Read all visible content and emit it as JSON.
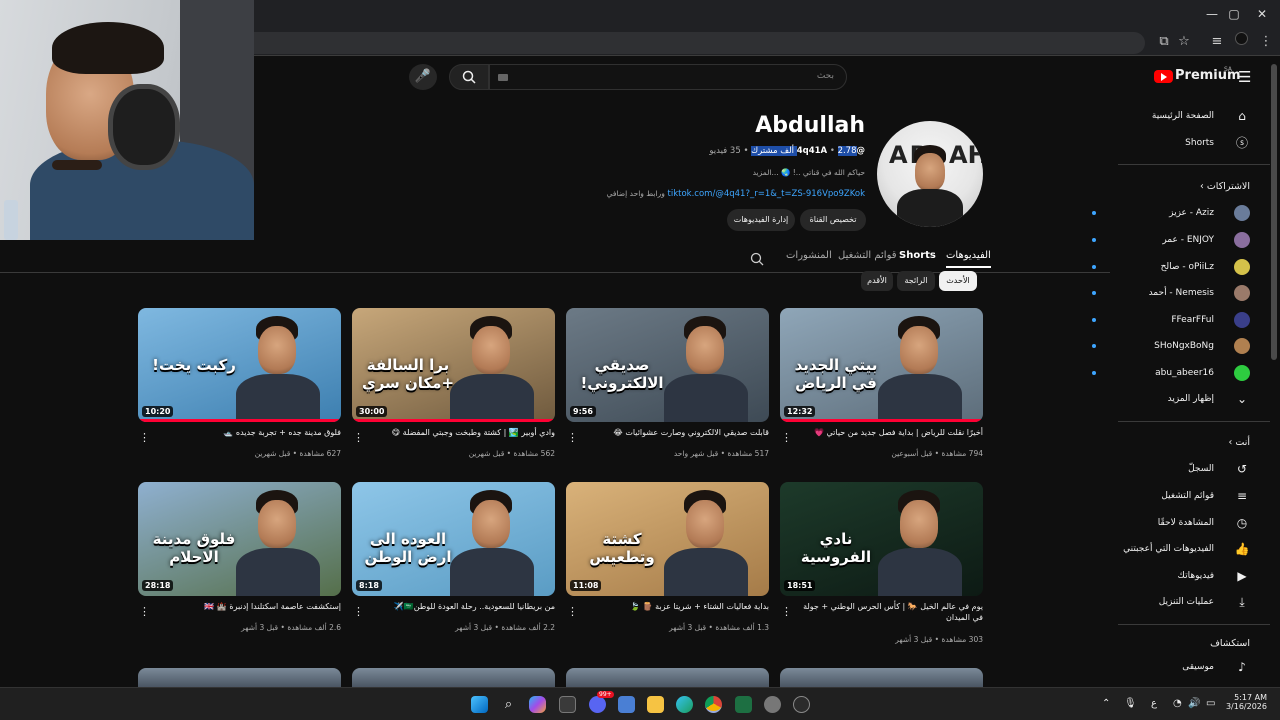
{
  "browser": {
    "window_controls": {
      "minimize": "—",
      "maximize": "▢",
      "close": "✕"
    }
  },
  "youtube": {
    "logo_text": "Premium",
    "logo_region": "SA",
    "search_placeholder": "بحث",
    "sidebar": {
      "main": [
        {
          "label": "الصفحة الرئيسية",
          "icon": "home-icon"
        },
        {
          "label": "Shorts",
          "icon": "shorts-icon"
        }
      ],
      "subscriptions_title": "الاشتراكات",
      "subscriptions": [
        {
          "label": "Aziz - عزيز",
          "color": "#6a7c9a"
        },
        {
          "label": "ENJOY - عمر",
          "color": "#8a6e9e"
        },
        {
          "label": "oPiiLz - صالح",
          "color": "#d4c14a"
        },
        {
          "label": "Nemesis - أحمد",
          "color": "#9a7a6a"
        },
        {
          "label": "FFearFFul",
          "color": "#3a3f8a"
        },
        {
          "label": "SHoNgxBoNg",
          "color": "#b08050"
        },
        {
          "label": "abu_abeer16",
          "color": "#2ecc40"
        }
      ],
      "show_more": "إظهار المزيد",
      "you_title": "أنت",
      "you": [
        {
          "label": "السجلّ",
          "icon": "history-icon"
        },
        {
          "label": "قوائم التشغيل",
          "icon": "playlists-icon"
        },
        {
          "label": "المشاهدة لاحقًا",
          "icon": "watch-later-icon"
        },
        {
          "label": "الفيديوهات التي أعجبتني",
          "icon": "liked-videos-icon"
        },
        {
          "label": "فيديوهاتك",
          "icon": "your-videos-icon"
        },
        {
          "label": "عمليات التنزيل",
          "icon": "downloads-icon"
        }
      ],
      "explore_title": "استكشاف",
      "explore": [
        {
          "label": "موسيقى",
          "icon": "music-icon"
        }
      ]
    },
    "channel": {
      "name": "Abdullah",
      "handle": "@4q41A",
      "subscribers": "2.78 ألف مشترك",
      "videos_count": "35 فيديو",
      "description": "حياكم الله في قناتي ..! 🌏 ...المزيد",
      "link": "tiktok.com/@4q41?_r=1&_t=ZS-916Vpo9ZKok",
      "link_suffix": "ورابط واحد إضافي",
      "customize_button": "تخصيص القناة",
      "manage_button": "إدارة الفيديوهات",
      "tabs": [
        "الفيديوهات",
        "Shorts",
        "قوائم التشغيل",
        "المنشورات"
      ],
      "chips": [
        "الأحدث",
        "الرائجة",
        "الأقدم"
      ]
    },
    "videos": [
      {
        "title": "أخيرًا نقلت للرياض | بداية فصل جديد من حياتي 💗",
        "meta": "794 مشاهدة • قبل أسبوعين",
        "duration": "12:32",
        "overlay": "بيتي الجديد في الرياض",
        "bg1": "#8fa6b8",
        "bg2": "#5d6d7a",
        "progress": 1.0
      },
      {
        "title": "قابلت صديقي الالكتروني وصارت عشوائيات 😂",
        "meta": "517 مشاهدة • قبل شهر واحد",
        "duration": "9:56",
        "overlay": "صديقي الالكتروني!",
        "bg1": "#6c7a86",
        "bg2": "#3e4a55",
        "progress": 0.0
      },
      {
        "title": "وادي أوبير 🏞️ | كشتة وطبخت وجبتي المفضلة 😋",
        "meta": "562 مشاهدة • قبل شهرين",
        "duration": "30:00",
        "overlay": "برا السالفة +مكان سري",
        "bg1": "#c7a77a",
        "bg2": "#6f5a3e",
        "progress": 1.0
      },
      {
        "title": "فلوق مدينة جده + تجربة جديده 🛥️",
        "meta": "627 مشاهدة • قبل شهرين",
        "duration": "10:20",
        "overlay": "ركبت يخت!",
        "bg1": "#7fb8e0",
        "bg2": "#3d7fb0",
        "progress": 1.0
      },
      {
        "title": "يوم في عالم الخيل 🐎 | كأس الحرس الوطني + جولة في الميدان",
        "meta": "303 مشاهدة • قبل 3 أشهر",
        "duration": "18:51",
        "overlay": "نادي الفروسية",
        "bg1": "#1d3a2a",
        "bg2": "#0d1a14",
        "progress": 0.0
      },
      {
        "title": "بداية فعاليات الشتاء + شريتا عزبة 🪵 🍃",
        "meta": "1.3 ألف مشاهدة • قبل 3 أشهر",
        "duration": "11:08",
        "overlay": "كشتة وتطعيس",
        "bg1": "#d9b27a",
        "bg2": "#a57b48",
        "progress": 0.0
      },
      {
        "title": "من بريطانيا للسعودية.. رحلة العودة للوطن🇸🇦✈️",
        "meta": "2.2 ألف مشاهدة • قبل 3 أشهر",
        "duration": "8:18",
        "overlay": "العوده الى ارض الوطن",
        "bg1": "#8ec6e8",
        "bg2": "#5a9cc4",
        "progress": 0.0
      },
      {
        "title": "إستكشفت عاصمة اسكتلندا إدنبرة 🏰 🇬🇧",
        "meta": "2.6 ألف مشاهدة • قبل 3 أشهر",
        "duration": "28:18",
        "overlay": "فلوق مدينة الاحلام",
        "bg1": "#8fb0d0",
        "bg2": "#556f4a",
        "progress": 0.0
      }
    ]
  },
  "taskbar": {
    "language": "ع",
    "time": "5:17 AM",
    "date": "3/16/2026",
    "discord_badge": "99+"
  }
}
